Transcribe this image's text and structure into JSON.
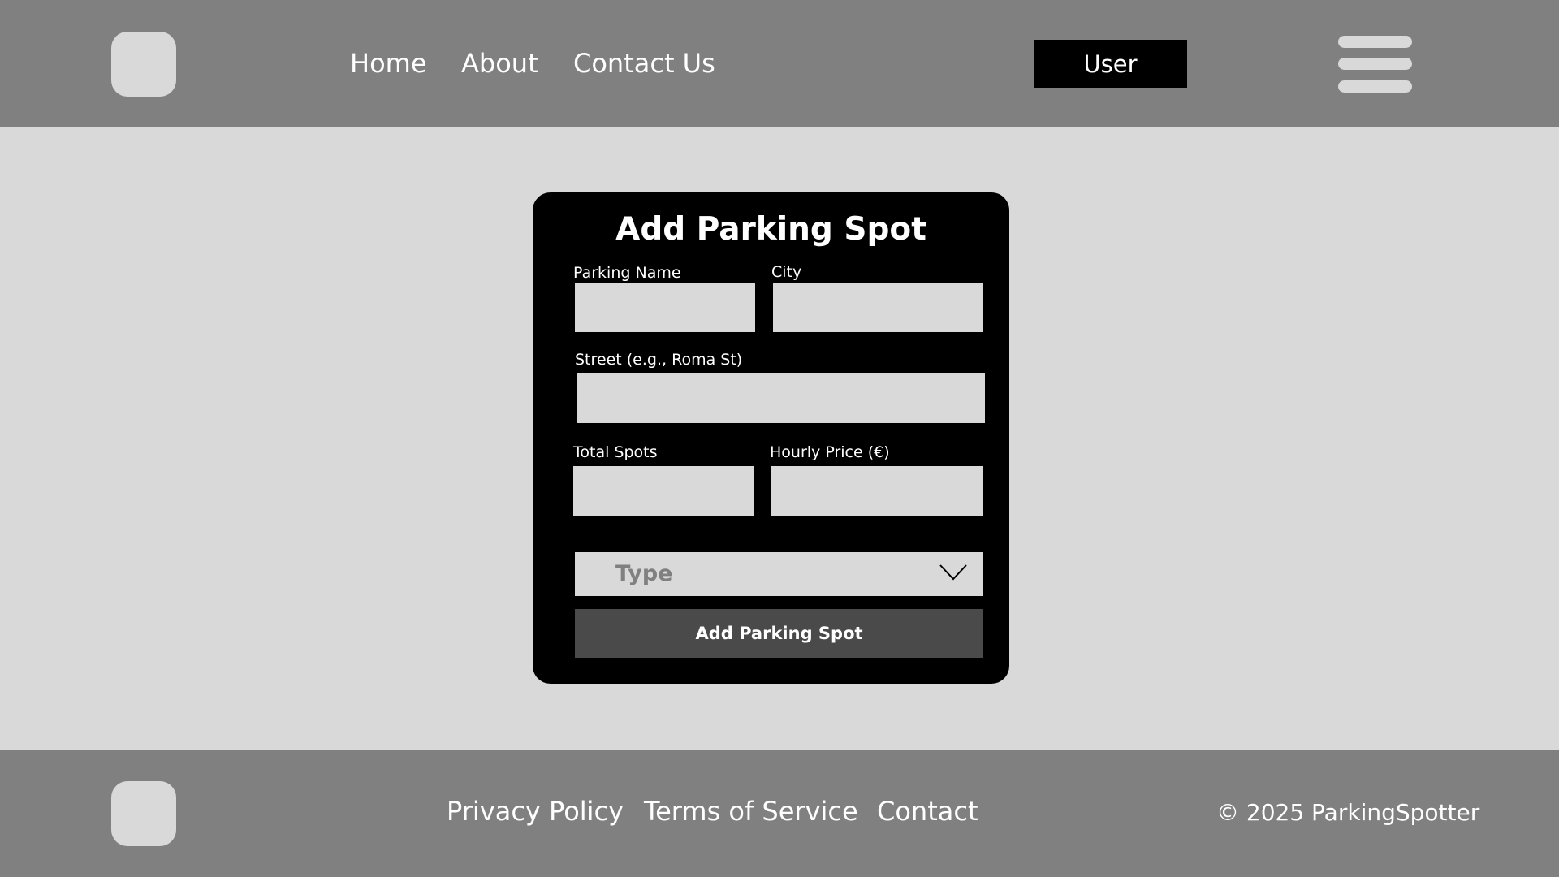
{
  "header": {
    "nav": [
      {
        "label": "Home"
      },
      {
        "label": "About"
      },
      {
        "label": "Contact Us"
      }
    ],
    "user_label": "User",
    "menu_icon": "hamburger-menu-icon",
    "logo_icon": "logo-placeholder-icon"
  },
  "form": {
    "title": "Add Parking Spot",
    "fields": {
      "parking_name": {
        "label": "Parking Name",
        "value": ""
      },
      "city": {
        "label": "City",
        "value": ""
      },
      "street": {
        "label": "Street (e.g., Roma St)",
        "value": ""
      },
      "total_spots": {
        "label": "Total Spots",
        "value": ""
      },
      "hourly_price": {
        "label": "Hourly Price (€)",
        "value": ""
      }
    },
    "type_select": {
      "placeholder": "Type",
      "icon": "chevron-down-icon"
    },
    "submit_label": "Add Parking Spot"
  },
  "footer": {
    "links": [
      {
        "label": "Privacy Policy"
      },
      {
        "label": "Terms of Service"
      },
      {
        "label": "Contact"
      }
    ],
    "copyright": "© 2025 ParkingSpotter",
    "logo_icon": "logo-placeholder-icon"
  },
  "colors": {
    "header_bg": "#808080",
    "page_bg": "#d9d9d9",
    "card_bg": "#000000",
    "button_bg": "#4a4a4a"
  }
}
